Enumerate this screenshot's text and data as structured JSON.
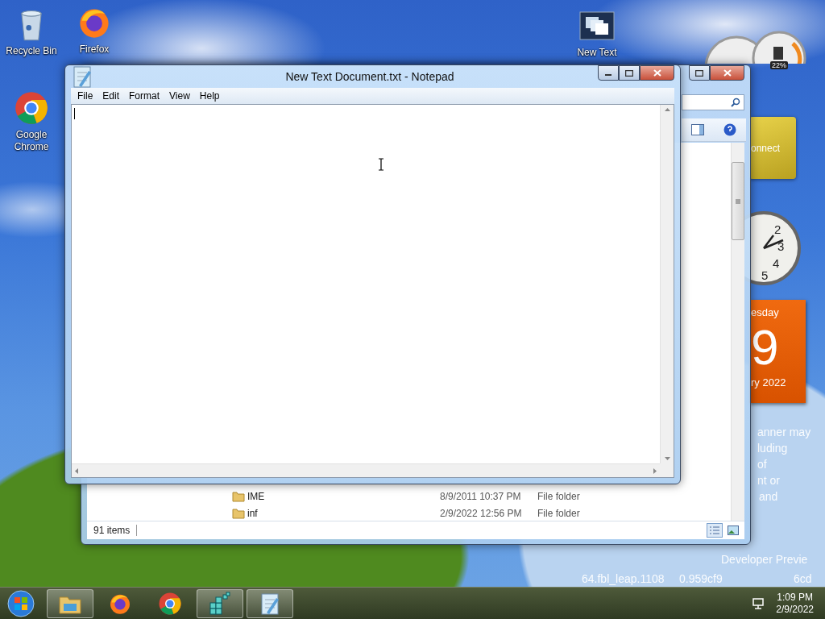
{
  "desktop_icons": [
    {
      "kind": "recycle",
      "label": "Recycle Bin"
    },
    {
      "kind": "firefox",
      "label": "Firefox"
    },
    {
      "kind": "document",
      "label": "New Text"
    },
    {
      "kind": "chrome",
      "label": "Google Chrome"
    }
  ],
  "explorer": {
    "rows": [
      {
        "name": "IME",
        "date": "8/9/2011 10:37 PM",
        "type": "File folder"
      },
      {
        "name": "inf",
        "date": "2/9/2022 12:56 PM",
        "type": "File folder"
      }
    ],
    "status": "91 items"
  },
  "notepad": {
    "title": "New Text Document.txt - Notepad",
    "menu": [
      "File",
      "Edit",
      "Format",
      "View",
      "Help"
    ]
  },
  "gadgets": {
    "meter": "22%",
    "feed": "onnect",
    "clock_numbers": [
      "2",
      "3",
      "4",
      "5"
    ],
    "calendar": {
      "day": "esday",
      "date": "9",
      "month": "ry 2022"
    }
  },
  "wallpaper_text": [
    "anner may",
    "luding",
    "of",
    "nt or",
    "and"
  ],
  "build_text": [
    "Developer Previe",
    "64.fbl_leap.1108",
    "0.959cf9",
    "6cd"
  ],
  "taskbar": {
    "items": [
      {
        "kind": "explorer",
        "running": true
      },
      {
        "kind": "firefox",
        "running": false
      },
      {
        "kind": "chrome",
        "running": false
      },
      {
        "kind": "registry",
        "running": true
      },
      {
        "kind": "notepad",
        "running": true
      }
    ],
    "time": "1:09 PM",
    "date": "2/9/2022"
  }
}
